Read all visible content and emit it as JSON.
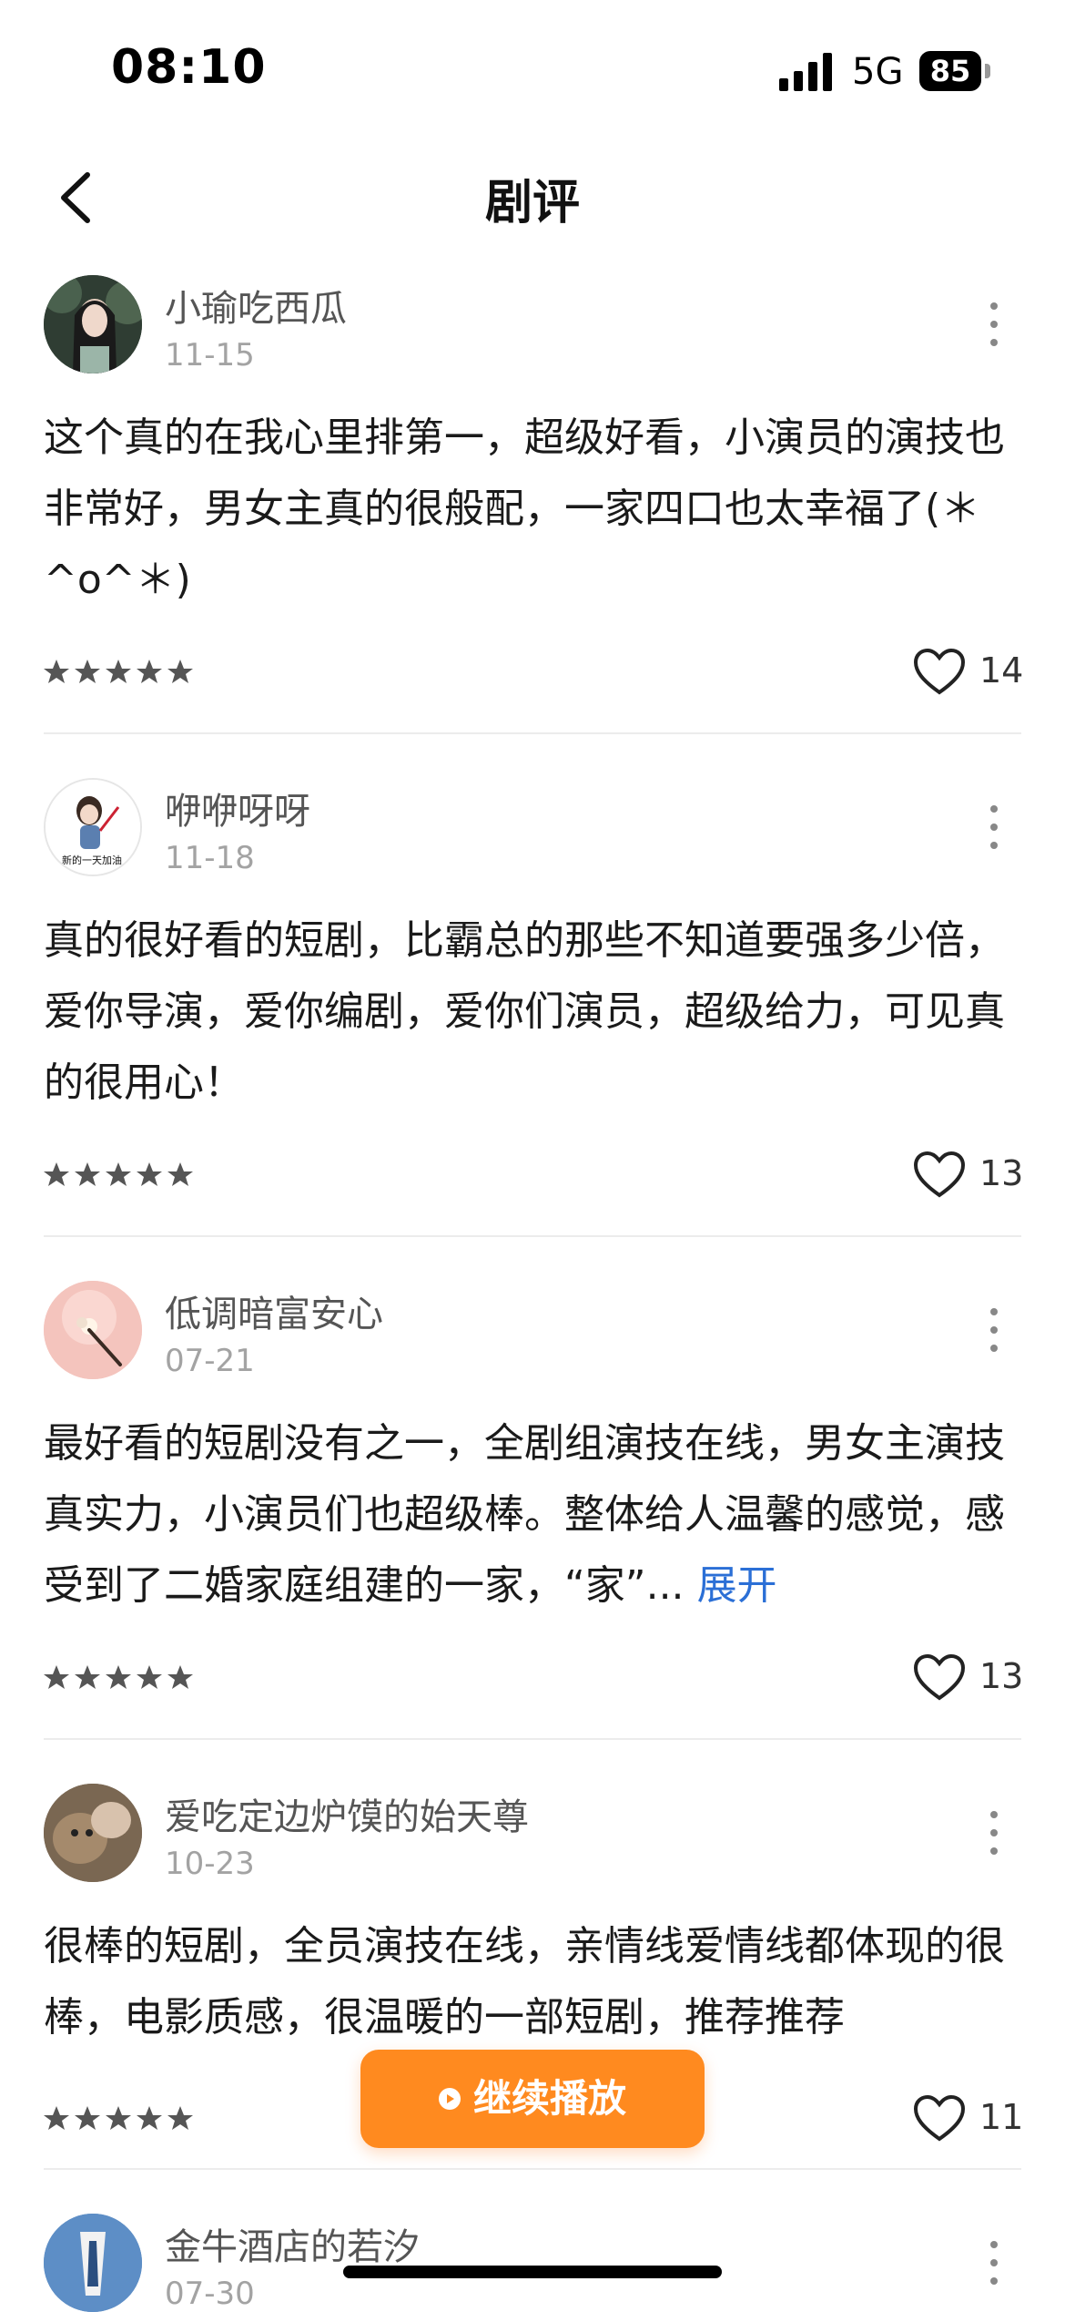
{
  "status_bar": {
    "time": "08:10",
    "network": "5G",
    "battery": "85"
  },
  "nav": {
    "title": "剧评"
  },
  "reviews": [
    {
      "username": "小瑜吃西瓜",
      "date": "11-15",
      "text": "这个真的在我心里排第一，超级好看，小演员的演技也非常好，男女主真的很般配，一家四口也太幸福了(＊^o^＊)",
      "likes": "14",
      "rating": 5
    },
    {
      "username": "咿咿呀呀",
      "date": "11-18",
      "text": "真的很好看的短剧，比霸总的那些不知道要强多少倍，爱你导演，爱你编剧，爱你们演员，超级给力，可见真的很用心！",
      "likes": "13",
      "rating": 5,
      "avatar_caption": "新的一天加油"
    },
    {
      "username": "低调暗富安心",
      "date": "07-21",
      "text": "最好看的短剧没有之一，全剧组演技在线，男女主演技真实力，小演员们也超级棒。整体给人温馨的感觉，感受到了二婚家庭组建的一家，“家”...",
      "expand_label": "展开",
      "likes": "13",
      "rating": 5
    },
    {
      "username": "爱吃定边炉馍的始天尊",
      "date": "10-23",
      "text": "很棒的短剧，全员演技在线，亲情线爱情线都体现的很棒，电影质感，很温暖的一部短剧，推荐推荐",
      "likes": "11",
      "rating": 5
    },
    {
      "username": "金牛酒店的若汐",
      "date": "07-30"
    }
  ],
  "play_button": {
    "label": "继续播放"
  },
  "colors": {
    "accent": "#ff8a1f",
    "link": "#2b6fd6",
    "star": "#555555"
  }
}
